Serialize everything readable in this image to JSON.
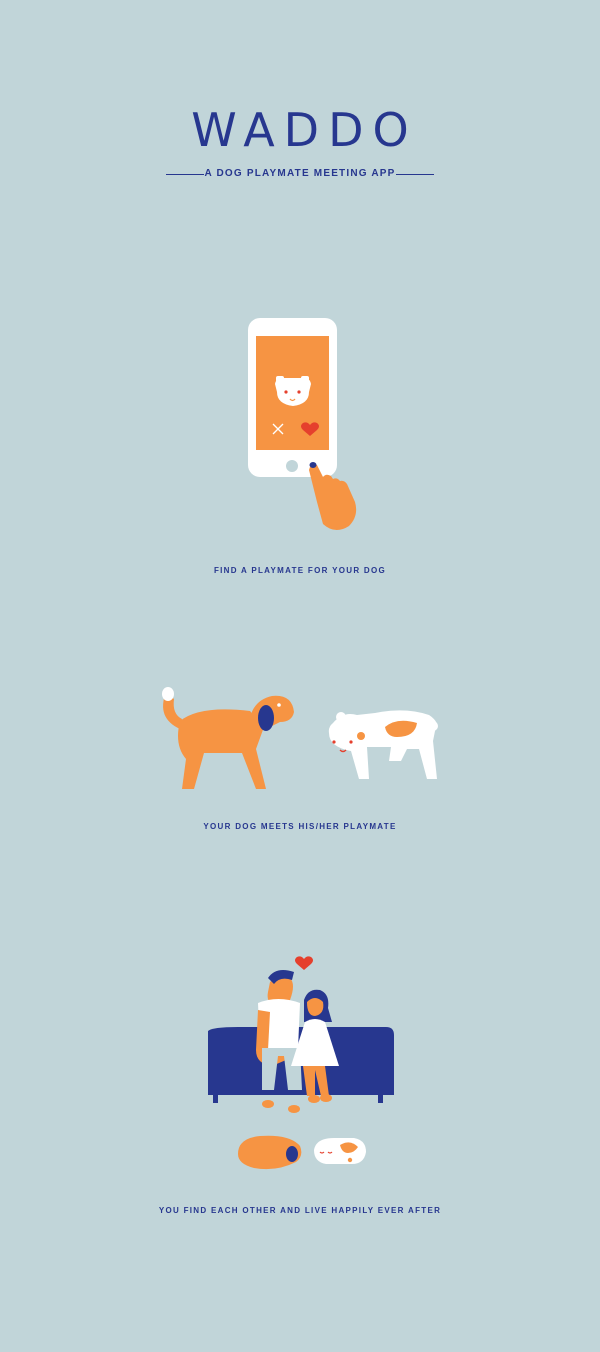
{
  "header": {
    "title": "WADDO",
    "subtitle": "A DOG PLAYMATE MEETING APP"
  },
  "steps": [
    {
      "caption": "FIND A PLAYMATE FOR YOUR DOG"
    },
    {
      "caption": "YOUR DOG MEETS HIS/HER PLAYMATE"
    },
    {
      "caption": "YOU FIND EACH OTHER AND LIVE HAPPILY EVER AFTER"
    }
  ],
  "colors": {
    "background": "#c1d5d9",
    "navy": "#27378f",
    "orange": "#f69443",
    "red": "#e5402d",
    "white": "#ffffff"
  }
}
